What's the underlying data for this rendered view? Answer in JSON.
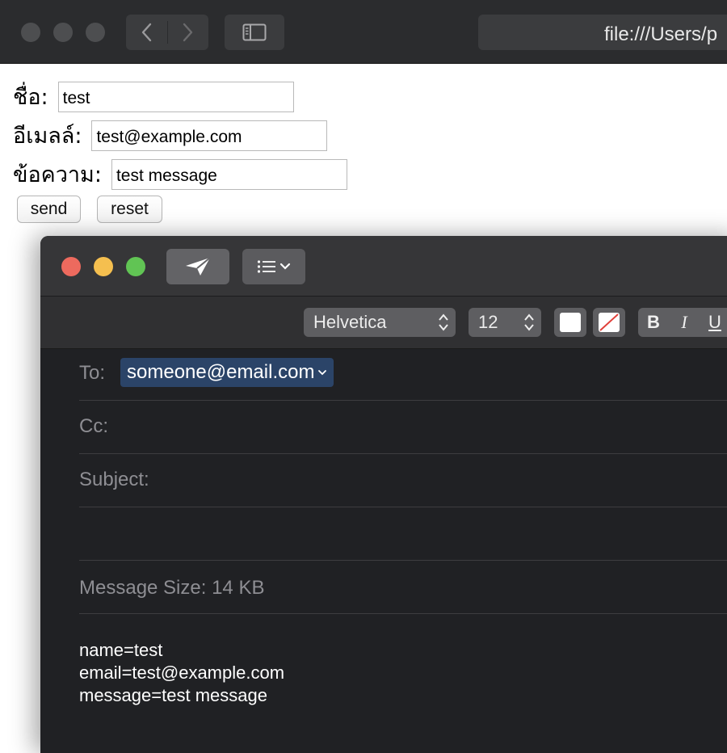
{
  "browser": {
    "url": "file:///Users/p",
    "icons": {
      "back": "chevron-left-icon",
      "forward": "chevron-right-icon",
      "sidebar": "sidebar-icon"
    }
  },
  "form": {
    "name_label": "ชื่อ:",
    "name_value": "test",
    "email_label": "อีเมลล์:",
    "email_value": "test@example.com",
    "message_label": "ข้อความ:",
    "message_value": "test message",
    "send_label": "send",
    "reset_label": "reset"
  },
  "mail": {
    "colors": {
      "close": "#ed6a5e",
      "minimize": "#f5bf4f",
      "zoom": "#61c454",
      "token": "#2b4468"
    },
    "font_family_select": "Helvetica",
    "font_size_select": "12",
    "bold_label": "B",
    "italic_label": "I",
    "underline_label": "U",
    "to_label": "To:",
    "to_recipient": "someone@email.com",
    "cc_label": "Cc:",
    "subject_label": "Subject:",
    "message_size": "Message Size: 14 KB",
    "body_lines": [
      "name=test",
      "email=test@example.com",
      "message=test message"
    ]
  }
}
